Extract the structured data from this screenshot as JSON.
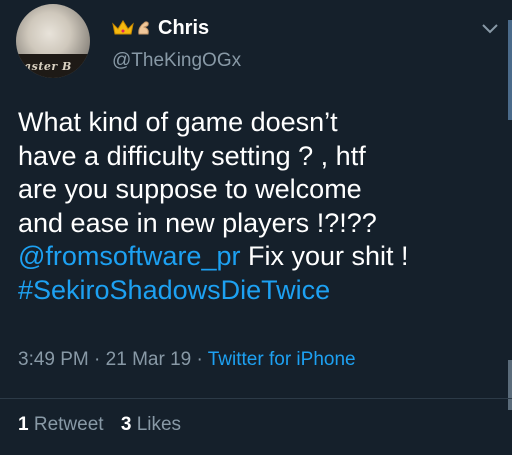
{
  "user": {
    "display_name": "Chris",
    "handle": "@TheKingOGx",
    "name_emoji": [
      "crown-icon",
      "flexed-biceps-icon"
    ],
    "avatar_caption": "aster B"
  },
  "tweet": {
    "lines": [
      "What kind of game doesn’t",
      "have a difficulty setting  ? , htf",
      "are you suppose to welcome",
      "and ease in new players !?!??"
    ],
    "mention": "@fromsoftware_pr",
    "after_mention": " Fix your shit !",
    "hashtag": "#SekiroShadowsDieTwice"
  },
  "meta": {
    "time": "3:49 PM",
    "separator": " · ",
    "date": "21 Mar 19",
    "source": "Twitter for iPhone"
  },
  "stats": {
    "retweets_count": "1",
    "retweets_label": "Retweet",
    "likes_count": "3",
    "likes_label": "Likes"
  },
  "colors": {
    "background": "#15202b",
    "link": "#1da1f2",
    "secondary_text": "#8899a6"
  }
}
